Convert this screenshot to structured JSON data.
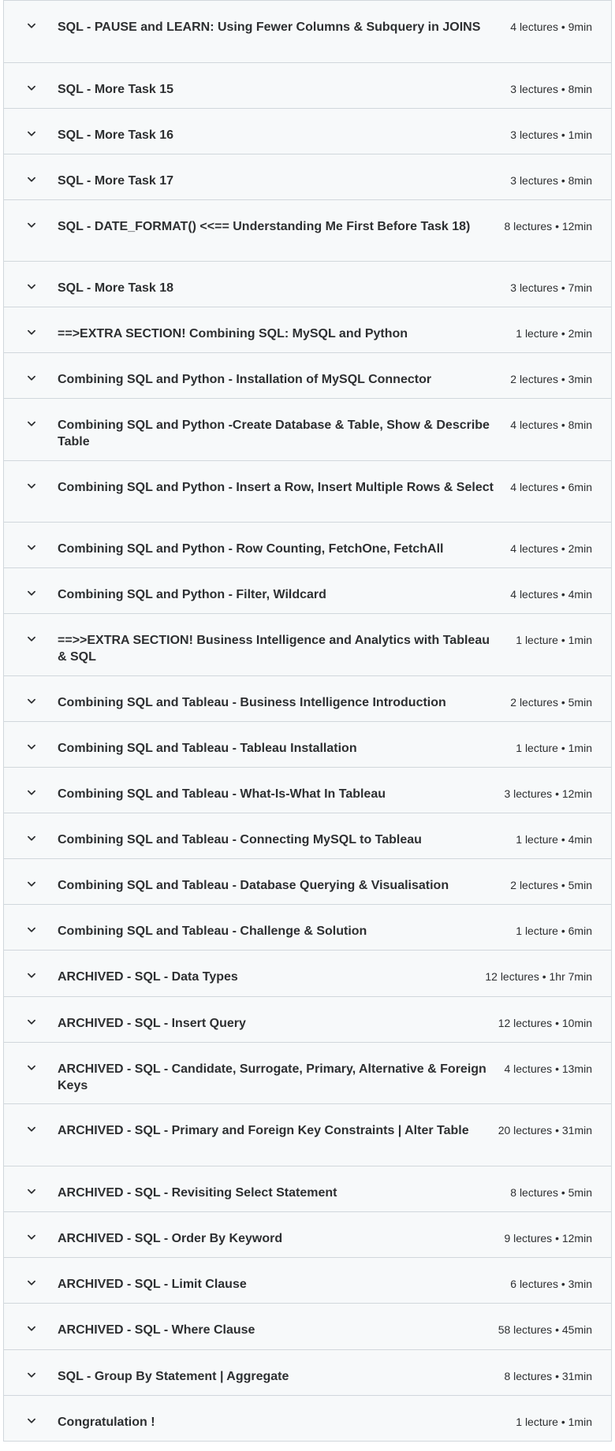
{
  "curriculum": {
    "sections": [
      {
        "title": "SQL - PAUSE and LEARN: Using Fewer Columns & Subquery in JOINS",
        "meta": "4 lectures • 9min"
      },
      {
        "title": "SQL - More Task 15",
        "meta": "3 lectures • 8min"
      },
      {
        "title": "SQL - More Task 16",
        "meta": "3 lectures • 1min"
      },
      {
        "title": "SQL - More Task 17",
        "meta": "3 lectures • 8min"
      },
      {
        "title": "SQL - DATE_FORMAT() <<== Understanding Me First Before Task 18)",
        "meta": "8 lectures • 12min"
      },
      {
        "title": "SQL - More Task 18",
        "meta": "3 lectures • 7min"
      },
      {
        "title": "==>EXTRA SECTION! Combining SQL: MySQL and Python",
        "meta": "1 lecture • 2min"
      },
      {
        "title": "Combining SQL and Python - Installation of MySQL Connector",
        "meta": "2 lectures • 3min"
      },
      {
        "title": "Combining SQL and Python -Create Database & Table, Show & Describe Table",
        "meta": "4 lectures • 8min"
      },
      {
        "title": "Combining SQL and Python - Insert a Row, Insert Multiple Rows & Select",
        "meta": "4 lectures • 6min"
      },
      {
        "title": "Combining SQL and Python - Row Counting, FetchOne, FetchAll",
        "meta": "4 lectures • 2min"
      },
      {
        "title": "Combining SQL and Python - Filter, Wildcard",
        "meta": "4 lectures • 4min"
      },
      {
        "title": "==>>EXTRA SECTION! Business Intelligence and Analytics with Tableau & SQL",
        "meta": "1 lecture • 1min"
      },
      {
        "title": "Combining SQL and Tableau - Business Intelligence Introduction",
        "meta": "2 lectures • 5min"
      },
      {
        "title": "Combining SQL and Tableau - Tableau Installation",
        "meta": "1 lecture • 1min"
      },
      {
        "title": "Combining SQL and Tableau - What-Is-What In Tableau",
        "meta": "3 lectures • 12min"
      },
      {
        "title": "Combining SQL and Tableau - Connecting MySQL to Tableau",
        "meta": "1 lecture • 4min"
      },
      {
        "title": "Combining SQL and Tableau - Database Querying & Visualisation",
        "meta": "2 lectures • 5min"
      },
      {
        "title": "Combining SQL and Tableau - Challenge & Solution",
        "meta": "1 lecture • 6min"
      },
      {
        "title": "ARCHIVED - SQL - Data Types",
        "meta": "12 lectures • 1hr 7min"
      },
      {
        "title": "ARCHIVED - SQL - Insert Query",
        "meta": "12 lectures • 10min"
      },
      {
        "title": "ARCHIVED - SQL - Candidate, Surrogate, Primary, Alternative & Foreign Keys",
        "meta": "4 lectures • 13min"
      },
      {
        "title": "ARCHIVED - SQL - Primary and Foreign Key Constraints | Alter Table",
        "meta": "20 lectures • 31min"
      },
      {
        "title": "ARCHIVED - SQL - Revisiting Select Statement",
        "meta": "8 lectures • 5min"
      },
      {
        "title": "ARCHIVED - SQL - Order By Keyword",
        "meta": "9 lectures • 12min"
      },
      {
        "title": "ARCHIVED - SQL - Limit Clause",
        "meta": "6 lectures • 3min"
      },
      {
        "title": "ARCHIVED - SQL - Where Clause",
        "meta": "58 lectures • 45min"
      },
      {
        "title": "SQL - Group By Statement | Aggregate",
        "meta": "8 lectures • 31min"
      },
      {
        "title": "Congratulation !",
        "meta": "1 lecture • 1min"
      }
    ]
  }
}
